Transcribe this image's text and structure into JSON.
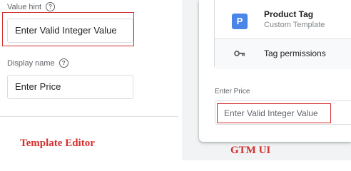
{
  "template_editor": {
    "value_hint_label": "Value hint",
    "value_hint_input": "Enter Valid Integer Value",
    "display_name_label": "Display name",
    "display_name_input": "Enter Price",
    "caption": "Template Editor"
  },
  "gtm_ui": {
    "tag_icon_letter": "P",
    "tag_title": "Product Tag",
    "tag_subtitle": "Custom Template",
    "permissions_label": "Tag permissions",
    "field_label": "Enter Price",
    "field_placeholder": "Enter Valid Integer Value",
    "caption": "GTM UI"
  },
  "colors": {
    "annotation_red": "#d32f2f",
    "tag_icon_blue": "#4a86e8"
  },
  "icons": {
    "help": "help-circle-icon",
    "key": "key-icon"
  }
}
